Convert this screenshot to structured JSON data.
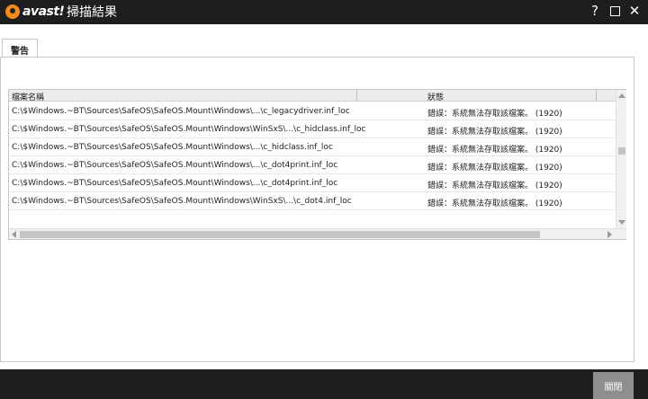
{
  "app": {
    "brand": "avast!",
    "title": "掃描結果"
  },
  "window_controls": {
    "help_label": "?",
    "close_label": "✕"
  },
  "tabs": [
    {
      "label": "警告"
    }
  ],
  "grid": {
    "columns": [
      "檔案名稱",
      "狀態"
    ],
    "rows": [
      {
        "file": "C:\\$Windows.~BT\\Sources\\SafeOS\\SafeOS.Mount\\Windows\\...\\c_legacydriver.inf_loc",
        "status": "錯誤：系統無法存取該檔案。 (1920)"
      },
      {
        "file": "C:\\$Windows.~BT\\Sources\\SafeOS\\SafeOS.Mount\\Windows\\WinSxS\\...\\c_hidclass.inf_loc",
        "status": "錯誤：系統無法存取該檔案。 (1920)"
      },
      {
        "file": "C:\\$Windows.~BT\\Sources\\SafeOS\\SafeOS.Mount\\Windows\\...\\c_hidclass.inf_loc",
        "status": "錯誤：系統無法存取該檔案。 (1920)"
      },
      {
        "file": "C:\\$Windows.~BT\\Sources\\SafeOS\\SafeOS.Mount\\Windows\\...\\c_dot4print.inf_loc",
        "status": "錯誤：系統無法存取該檔案。 (1920)"
      },
      {
        "file": "C:\\$Windows.~BT\\Sources\\SafeOS\\SafeOS.Mount\\Windows\\...\\c_dot4print.inf_loc",
        "status": "錯誤：系統無法存取該檔案。 (1920)"
      },
      {
        "file": "C:\\$Windows.~BT\\Sources\\SafeOS\\SafeOS.Mount\\Windows\\WinSxS\\...\\c_dot4.inf_loc",
        "status": "錯誤：系統無法存取該檔案。 (1920)"
      }
    ]
  },
  "footer": {
    "close_button_label": "關閉"
  },
  "colors": {
    "titlebar_bg": "#1e1e1e",
    "brand_orange": "#f28a1c",
    "button_gray": "#8e8e8e"
  }
}
